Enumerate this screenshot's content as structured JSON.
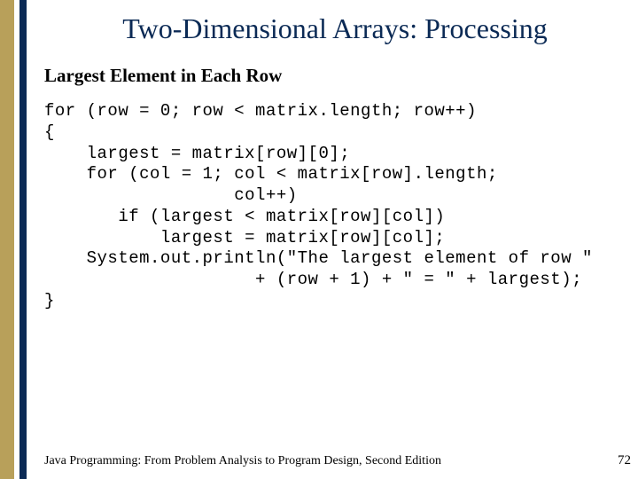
{
  "slide": {
    "title": "Two-Dimensional Arrays: Processing",
    "subtitle": "Largest Element in Each Row"
  },
  "code": {
    "line1": "for (row = 0; row < matrix.length; row++)",
    "line2": "{",
    "line3": "    largest = matrix[row][0];",
    "line4": "    for (col = 1; col < matrix[row].length;",
    "line5": "                  col++)",
    "line6": "       if (largest < matrix[row][col])",
    "line7": "           largest = matrix[row][col];",
    "line8": "    System.out.println(\"The largest element of row \"",
    "line9": "                    + (row + 1) + \" = \" + largest);",
    "line10": "}"
  },
  "footer": {
    "text": "Java Programming: From Problem Analysis to Program Design, Second Edition",
    "page": "72"
  }
}
